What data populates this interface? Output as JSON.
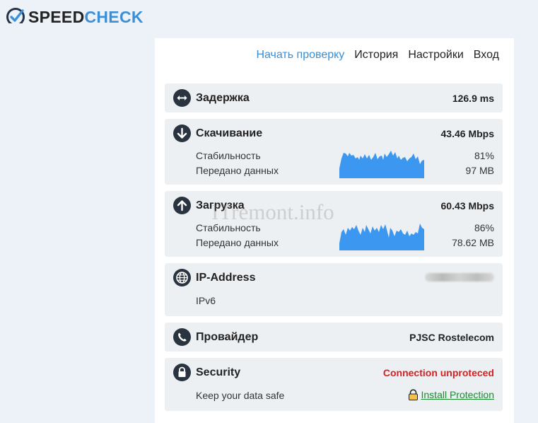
{
  "app": {
    "logo_speed": "SPEED",
    "logo_check": "CHECK"
  },
  "nav": {
    "items": [
      {
        "label": "Начать проверку",
        "active": true
      },
      {
        "label": "История",
        "active": false
      },
      {
        "label": "Настройки",
        "active": false
      },
      {
        "label": "Вход",
        "active": false
      }
    ]
  },
  "latency": {
    "title": "Задержка",
    "value": "126.9 ms",
    "icon": "horizontal-arrows-icon"
  },
  "download": {
    "title": "Скачивание",
    "value": "43.46 Mbps",
    "icon": "arrow-down-icon",
    "stability_label": "Стабильность",
    "stability_value": "81%",
    "transferred_label": "Передано данных",
    "transferred_value": "97 MB",
    "graph_color": "#3b97ef"
  },
  "upload": {
    "title": "Загрузка",
    "value": "60.43 Mbps",
    "icon": "arrow-up-icon",
    "stability_label": "Стабильность",
    "stability_value": "86%",
    "transferred_label": "Передано данных",
    "transferred_value": "78.62 MB",
    "graph_color": "#3b97ef"
  },
  "ip": {
    "title": "IP-Address",
    "version": "IPv6",
    "icon": "globe-icon"
  },
  "provider": {
    "title": "Провайдер",
    "value": "PJSC Rostelecom",
    "icon": "phone-icon"
  },
  "security": {
    "title": "Security",
    "status": "Connection unproteced",
    "status_color": "#d62020",
    "subtitle": "Keep your data safe",
    "install_label": "Install Protection",
    "icon": "lock-icon"
  },
  "watermark": "ITremont.info"
}
